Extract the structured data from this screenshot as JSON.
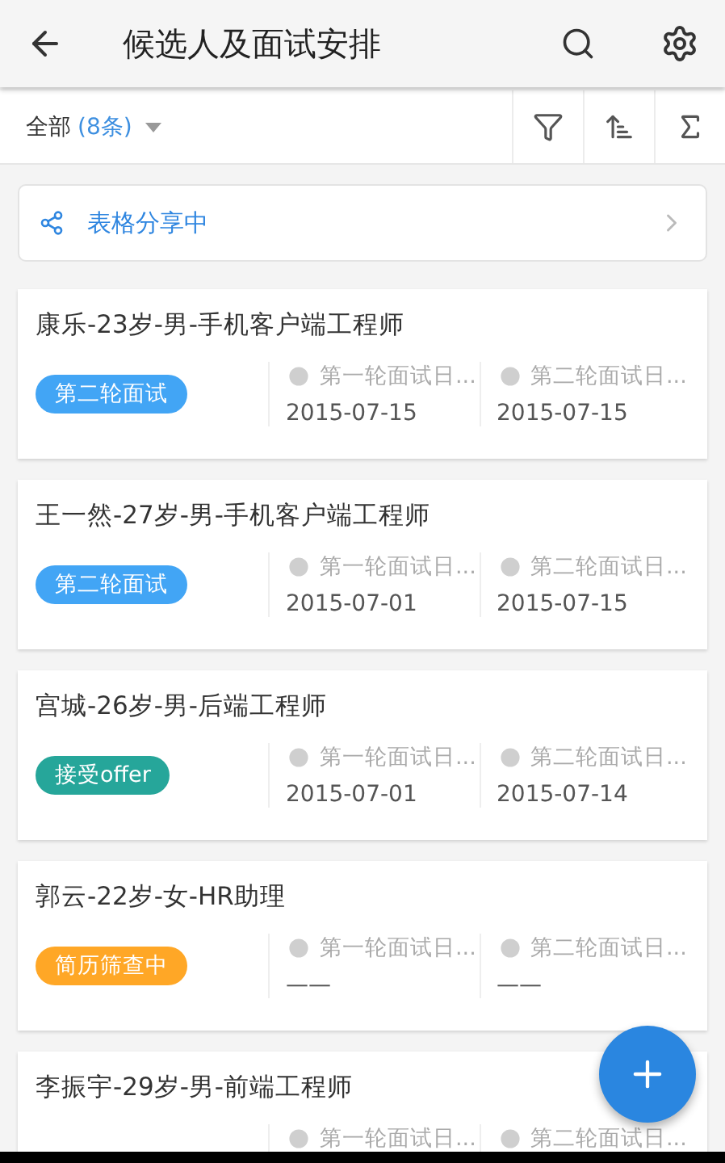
{
  "app_bar": {
    "title": "候选人及面试安排"
  },
  "filter_bar": {
    "scope": "全部",
    "count": "(8条)"
  },
  "share_banner": {
    "label": "表格分享中"
  },
  "candidates": [
    {
      "title": "康乐-23岁-男-手机客户端工程师",
      "status": {
        "label": "第二轮面试",
        "color": "#42a5f5"
      },
      "fields": [
        {
          "label": "第一轮面试日...",
          "value": "2015-07-15"
        },
        {
          "label": "第二轮面试日...",
          "value": "2015-07-15"
        }
      ]
    },
    {
      "title": "王一然-27岁-男-手机客户端工程师",
      "status": {
        "label": "第二轮面试",
        "color": "#42a5f5"
      },
      "fields": [
        {
          "label": "第一轮面试日...",
          "value": "2015-07-01"
        },
        {
          "label": "第二轮面试日...",
          "value": "2015-07-15"
        }
      ]
    },
    {
      "title": "宫城-26岁-男-后端工程师",
      "status": {
        "label": "接受offer",
        "color": "#26a69a"
      },
      "fields": [
        {
          "label": "第一轮面试日...",
          "value": "2015-07-01"
        },
        {
          "label": "第二轮面试日...",
          "value": "2015-07-14"
        }
      ]
    },
    {
      "title": "郭云-22岁-女-HR助理",
      "status": {
        "label": "简历筛查中",
        "color": "#ffa726"
      },
      "fields": [
        {
          "label": "第一轮面试日...",
          "value": "——"
        },
        {
          "label": "第二轮面试日...",
          "value": "——"
        }
      ]
    },
    {
      "title": "李振宇-29岁-男-前端工程师",
      "fields": [
        {
          "label": "第一轮面试日..."
        },
        {
          "label": "第二轮面试日..."
        }
      ]
    }
  ]
}
